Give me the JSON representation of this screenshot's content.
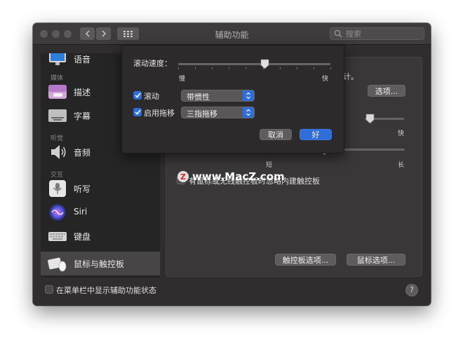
{
  "window": {
    "title": "辅助功能",
    "search_placeholder": "搜索"
  },
  "sidebar": {
    "items": [
      {
        "label": "语音",
        "icon": "display-icon"
      },
      {
        "label": "描述",
        "icon": "description-icon"
      },
      {
        "label": "字幕",
        "icon": "captions-icon"
      },
      {
        "label": "音频",
        "icon": "speaker-icon"
      },
      {
        "label": "听写",
        "icon": "microphone-icon"
      },
      {
        "label": "Siri",
        "icon": "siri-icon"
      },
      {
        "label": "键盘",
        "icon": "keyboard-icon"
      },
      {
        "label": "鼠标与触控板",
        "icon": "mouse-trackpad-icon",
        "selected": true
      }
    ],
    "sections": [
      "媒体",
      "听觉",
      "交互"
    ]
  },
  "main": {
    "partial_text": "计。",
    "options_button": "选项...",
    "slider1_right_label": "快",
    "slider2_left_label": "短",
    "slider2_right_label": "长",
    "ignore_builtin_checkbox": "有鼠标或无线触控板时忽略内建触控板",
    "trackpad_options_button": "触控板选项...",
    "mouse_options_button": "鼠标选项..."
  },
  "footer": {
    "show_status_checkbox": "在菜单栏中显示辅助功能状态",
    "help": "?"
  },
  "sheet": {
    "scroll_speed_label": "滚动速度：",
    "slow_label": "慢",
    "fast_label": "快",
    "scroll_speed_fraction": 0.57,
    "scroll_checkbox_label": "滚动",
    "scroll_checked": true,
    "scroll_popup_value": "带惯性",
    "drag_checkbox_label": "启用拖移",
    "drag_checked": true,
    "drag_popup_value": "三指拖移",
    "cancel_button": "取消",
    "ok_button": "好"
  },
  "watermark": {
    "logo_letter": "Z",
    "text": "www.MacZ.com"
  },
  "colors": {
    "accent": "#2f6ed8",
    "window_bg": "#2f2d2d",
    "sidebar_bg": "#262525",
    "selected_row": "#474545"
  }
}
